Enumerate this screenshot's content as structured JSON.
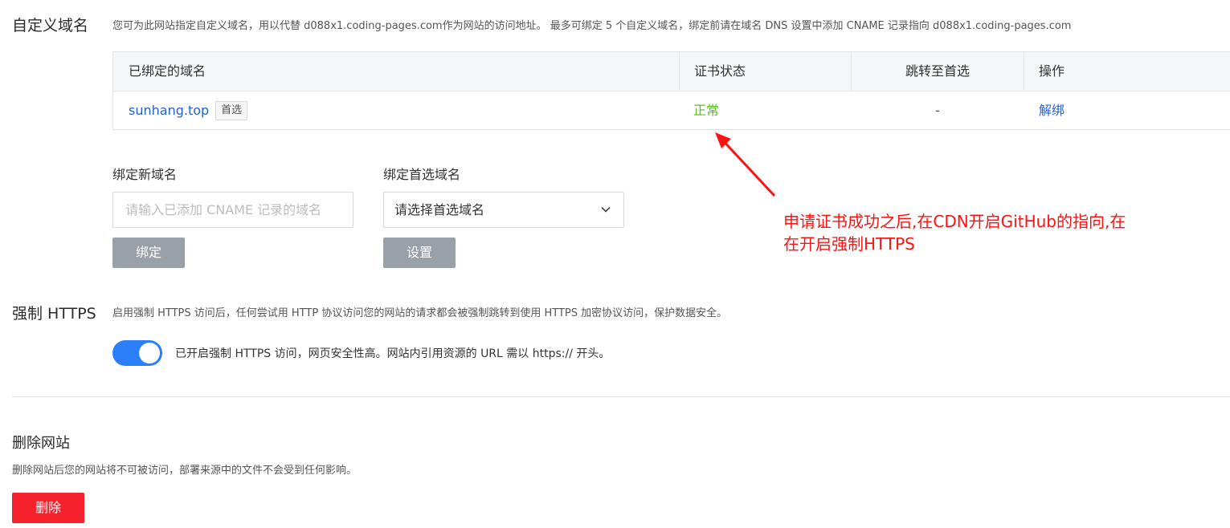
{
  "custom_domain": {
    "title": "自定义域名",
    "description": "您可为此网站指定自定义域名，用以代替 d088x1.coding-pages.com作为网站的访问地址。 最多可绑定 5 个自定义域名，绑定前请在域名 DNS 设置中添加 CNAME 记录指向 d088x1.coding-pages.com",
    "table": {
      "headers": [
        "已绑定的域名",
        "证书状态",
        "跳转至首选",
        "操作"
      ],
      "rows": [
        {
          "domain": "sunhang.top",
          "tag": "首选",
          "cert_status": "正常",
          "redirect": "-",
          "action": "解绑"
        }
      ]
    },
    "bind_new": {
      "label": "绑定新域名",
      "placeholder": "请输入已添加 CNAME 记录的域名",
      "button": "绑定"
    },
    "bind_preferred": {
      "label": "绑定首选域名",
      "select_value": "请选择首选域名",
      "button": "设置"
    }
  },
  "https": {
    "title": "强制 HTTPS",
    "description": "启用强制 HTTPS 访问后，任何尝试用 HTTP 协议访问您的网站的请求都会被强制跳转到使用 HTTPS 加密协议访问，保护数据安全。",
    "toggle_on": true,
    "toggle_text": "已开启强制 HTTPS 访问，网页安全性高。网站内引用资源的 URL 需以 https:// 开头。"
  },
  "delete_site": {
    "title": "删除网站",
    "description": "删除网站后您的网站将不可被访问，部署来源中的文件不会受到任何影响。",
    "button": "删除"
  },
  "annotation": {
    "line1": "申请证书成功之后,在CDN开启GitHub的指向,在",
    "line2": "在开启强制HTTPS"
  },
  "colors": {
    "link": "#2462d4",
    "status_ok": "#52c41a",
    "toggle": "#2d7ff9",
    "danger": "#f5222d",
    "annotation": "#ff1111"
  }
}
